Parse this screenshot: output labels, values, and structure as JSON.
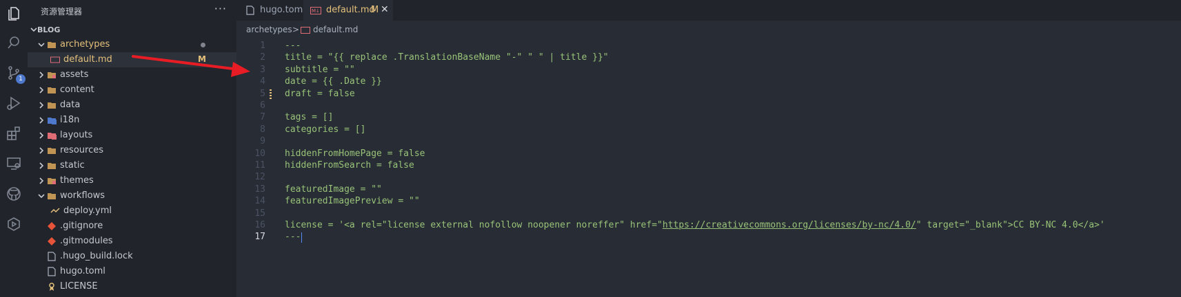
{
  "sidebar": {
    "title": "资源管理器",
    "more": "···",
    "root": "BLOG",
    "items": [
      {
        "label": "archetypes",
        "indent": 1,
        "type": "folder-open",
        "modified": true,
        "status": "dot"
      },
      {
        "label": "default.md",
        "indent": 2,
        "type": "md",
        "modified": true,
        "status": "M",
        "selected": true
      },
      {
        "label": "assets",
        "indent": 1,
        "type": "folder-assets"
      },
      {
        "label": "content",
        "indent": 1,
        "type": "folder"
      },
      {
        "label": "data",
        "indent": 1,
        "type": "folder"
      },
      {
        "label": "i18n",
        "indent": 1,
        "type": "folder-i18n"
      },
      {
        "label": "layouts",
        "indent": 1,
        "type": "folder-layout"
      },
      {
        "label": "resources",
        "indent": 1,
        "type": "folder"
      },
      {
        "label": "static",
        "indent": 1,
        "type": "folder"
      },
      {
        "label": "themes",
        "indent": 1,
        "type": "folder-themes"
      },
      {
        "label": "workflows",
        "indent": 1,
        "type": "folder-open"
      },
      {
        "label": "deploy.yml",
        "indent": 2,
        "type": "yml",
        "leaf": true
      },
      {
        "label": ".gitignore",
        "indent": 1,
        "type": "git",
        "leaf": true
      },
      {
        "label": ".gitmodules",
        "indent": 1,
        "type": "git",
        "leaf": true
      },
      {
        "label": ".hugo_build.lock",
        "indent": 1,
        "type": "file",
        "leaf": true
      },
      {
        "label": "hugo.toml",
        "indent": 1,
        "type": "file",
        "leaf": true
      },
      {
        "label": "LICENSE",
        "indent": 1,
        "type": "license",
        "leaf": true
      }
    ]
  },
  "tabs": [
    {
      "label": "hugo.toml",
      "active": false
    },
    {
      "label": "default.md",
      "modified": "M",
      "active": true,
      "close": "✕"
    }
  ],
  "breadcrumb": {
    "folder": "archetypes",
    "sep": ">",
    "file": "default.md"
  },
  "code": {
    "current_line": 17,
    "lines": [
      "---",
      "title = \"{{ replace .TranslationBaseName \"-\" \" \" | title }}\"",
      "subtitle = \"\"",
      "date = {{ .Date }}",
      "draft = false",
      "",
      "tags = []",
      "categories = []",
      "",
      "hiddenFromHomePage = false",
      "hiddenFromSearch = false",
      "",
      "featuredImage = \"\"",
      "featuredImagePreview = \"\"",
      "",
      "license = '<a rel=\"license external nofollow noopener noreffer\" href=\"https://creativecommons.org/licenses/by-nc/4.0/\" target=\"_blank\">CC BY-NC 4.0</a>'",
      "---"
    ]
  },
  "activity": {
    "icons": [
      "files-icon",
      "search-icon",
      "source-control-icon",
      "run-debug-icon",
      "extensions-icon",
      "remote-explorer-icon",
      "github-icon",
      "deploy-icon"
    ],
    "badge": "1"
  },
  "colors": {
    "accent": "#e5c07b",
    "string": "#98c379",
    "arrow": "#e81c24"
  }
}
